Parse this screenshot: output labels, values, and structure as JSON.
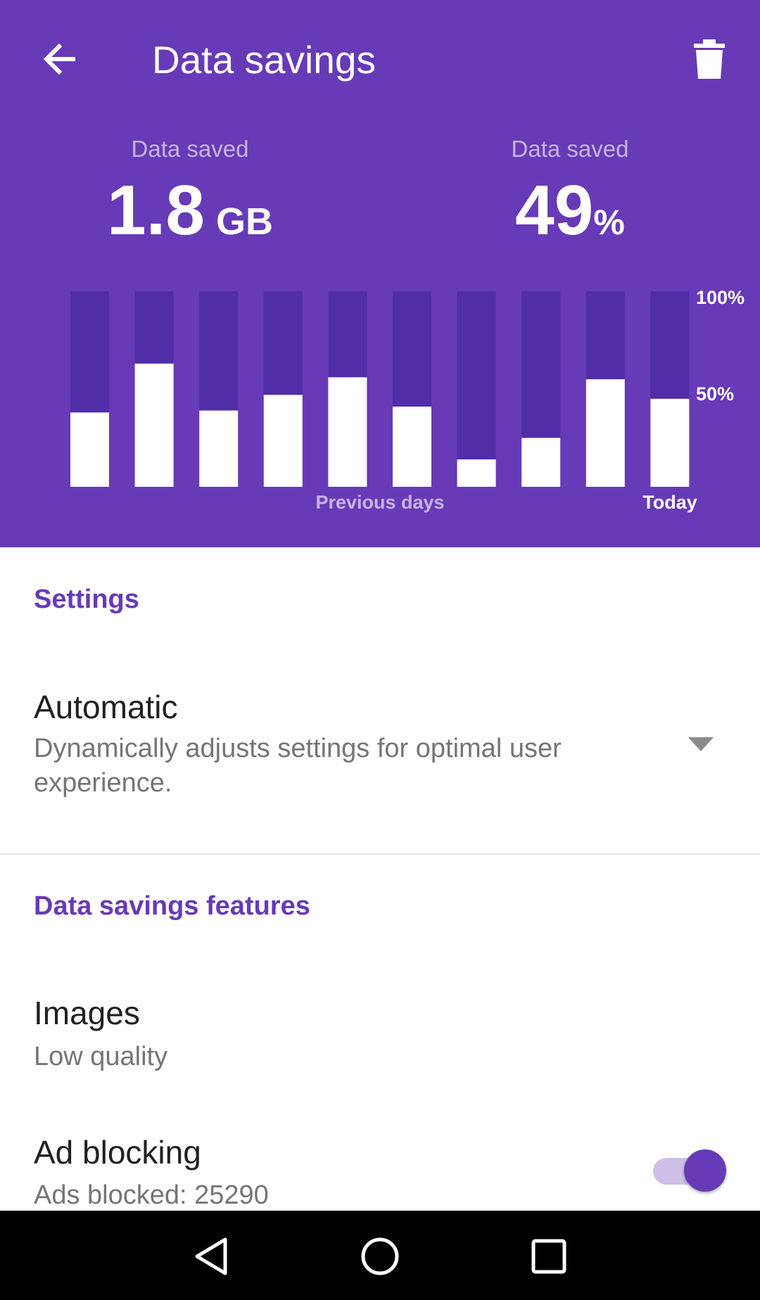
{
  "app_bar": {
    "title": "Data savings",
    "back_icon": "arrow-left-icon",
    "delete_icon": "trash-icon"
  },
  "stats": {
    "left": {
      "label": "Data saved",
      "value": "1.8",
      "unit": "GB"
    },
    "right": {
      "label": "Data saved",
      "value": "49",
      "unit": "%"
    }
  },
  "chart_data": {
    "type": "bar",
    "values": [
      38,
      63,
      39,
      47,
      56,
      41,
      14,
      25,
      55,
      45
    ],
    "ylim": [
      0,
      100
    ],
    "yticks": [
      "100%",
      "50%"
    ],
    "xlabel": "Previous days",
    "xlabel_right": "Today",
    "colors": {
      "fill": "#ffffff",
      "remainder": "#512da8"
    }
  },
  "settings": {
    "section_title": "Settings",
    "mode": {
      "title": "Automatic",
      "description": "Dynamically adjusts settings for optimal user experience.",
      "icon": "dropdown-arrow-icon"
    }
  },
  "features": {
    "section_title": "Data savings features",
    "images": {
      "title": "Images",
      "value": "Low quality"
    },
    "ad_blocking": {
      "title": "Ad blocking",
      "value": "Ads blocked: 25290",
      "enabled": true
    }
  },
  "nav": {
    "back_icon": "nav-back-icon",
    "home_icon": "nav-home-icon",
    "recents_icon": "nav-recents-icon"
  },
  "theme": {
    "primary": "#673ab7",
    "primary_dark": "#512da8",
    "accent_light": "#cfc0ea"
  }
}
